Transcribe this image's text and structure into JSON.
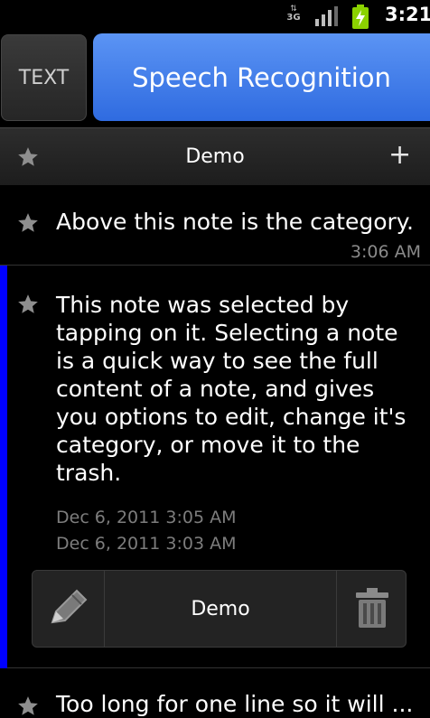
{
  "status_bar": {
    "network": "3G",
    "time": "3:21"
  },
  "mode_buttons": {
    "text_label": "TEXT",
    "speech_label": "Speech Recognition"
  },
  "category_bar": {
    "label": "Demo",
    "add_label": "+"
  },
  "notes": [
    {
      "text": "Above this note is the category.",
      "time": "3:06 AM"
    },
    {
      "text": "This note was selected by tapping on it. Selecting a note is a quick way to see the full content of a note, and gives you options to edit, change it's category, or move it to the trash.",
      "date_modified": "Dec 6, 2011 3:05 AM",
      "date_created": "Dec 6, 2011 3:03 AM",
      "actions": {
        "category_label": "Demo"
      }
    },
    {
      "text": "Too long for one line so it will ..."
    }
  ],
  "colors": {
    "accent_blue": "#3d7ae8",
    "selection_bar": "#0000ff",
    "battery_green": "#8bd200"
  }
}
